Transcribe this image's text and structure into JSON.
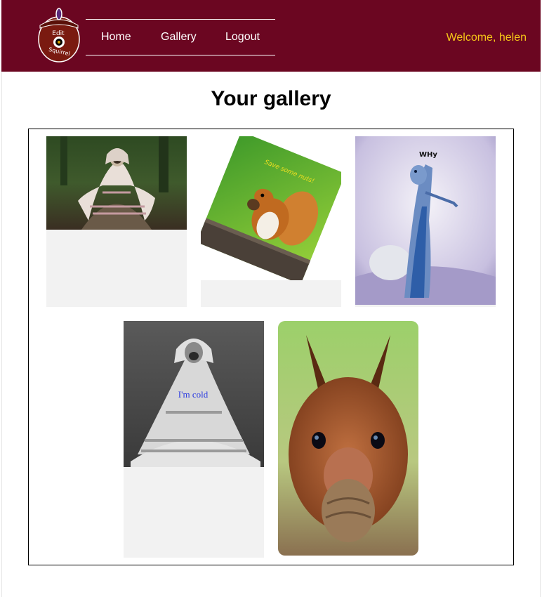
{
  "header": {
    "logo_text_top": "Edit",
    "logo_text_bottom": "Squirrel",
    "nav": [
      {
        "label": "Home"
      },
      {
        "label": "Gallery"
      },
      {
        "label": "Logout"
      }
    ],
    "welcome": "Welcome, helen"
  },
  "main": {
    "title": "Your gallery",
    "images": [
      {
        "name": "pug-blanket-forest",
        "caption": ""
      },
      {
        "name": "squirrel-eating-nuts-rotated",
        "caption": "Save some nuts!"
      },
      {
        "name": "squirrel-standing-inverted",
        "caption": "WHy"
      },
      {
        "name": "pug-blanket-grayscale",
        "caption": "I'm cold"
      },
      {
        "name": "squirrel-holding-walnut",
        "caption": ""
      }
    ]
  },
  "colors": {
    "header_bg": "#6b0621",
    "welcome_text": "#f5c518",
    "card_bg": "#f2f2f2"
  }
}
